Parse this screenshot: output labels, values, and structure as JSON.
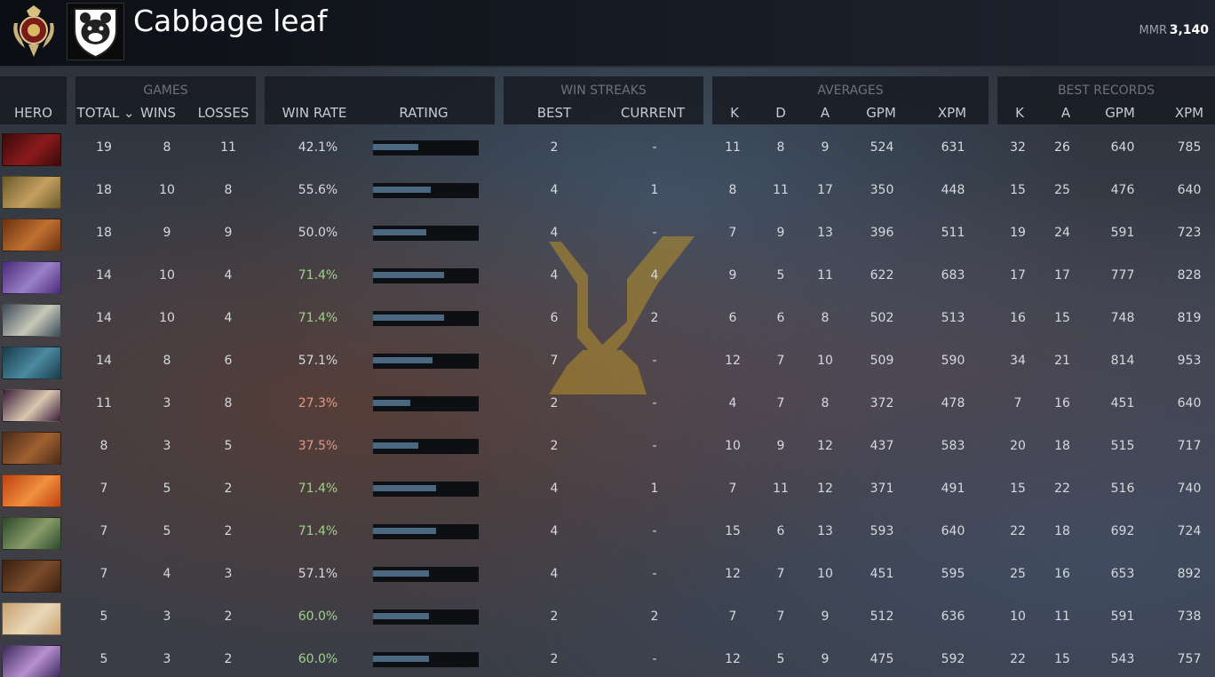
{
  "player": {
    "name": "Cabbage leaf",
    "mmr_label": "MMR",
    "mmr_value": "3,140"
  },
  "headers": {
    "hero": "HERO",
    "games": {
      "group": "GAMES",
      "total": "TOTAL ⌄",
      "wins": "WINS",
      "losses": "LOSSES"
    },
    "win_rate": "WIN RATE",
    "rating": "RATING",
    "win_streaks": {
      "group": "WIN STREAKS",
      "best": "BEST",
      "current": "CURRENT"
    },
    "averages": {
      "group": "AVERAGES",
      "k": "K",
      "d": "D",
      "a": "A",
      "gpm": "GPM",
      "xpm": "XPM"
    },
    "best_records": {
      "group": "BEST RECORDS",
      "k": "K",
      "a": "A",
      "gpm": "GPM",
      "xpm": "XPM"
    }
  },
  "colors": {
    "win_good": "#9fd08a",
    "win_bad": "#e09a86",
    "win_neutral": "#d6dade",
    "rating_bar": "#4a6880"
  },
  "rows": [
    {
      "hero": "shadow-fiend",
      "portrait": [
        "#3a0a0a",
        "#8b1b1b"
      ],
      "total": "19",
      "wins": "8",
      "losses": "11",
      "win_rate": "42.1%",
      "rating": 0.43,
      "streak_best": "2",
      "streak_current": "-",
      "avg_k": "11",
      "avg_d": "8",
      "avg_a": "9",
      "avg_gpm": "524",
      "avg_xpm": "631",
      "best_k": "32",
      "best_a": "26",
      "best_gpm": "640",
      "best_xpm": "785"
    },
    {
      "hero": "alchemist",
      "portrait": [
        "#6a5a2a",
        "#c4a060"
      ],
      "total": "18",
      "wins": "10",
      "losses": "8",
      "win_rate": "55.6%",
      "rating": 0.55,
      "streak_best": "4",
      "streak_current": "1",
      "avg_k": "8",
      "avg_d": "11",
      "avg_a": "17",
      "avg_gpm": "350",
      "avg_xpm": "448",
      "best_k": "15",
      "best_a": "25",
      "best_gpm": "476",
      "best_xpm": "640"
    },
    {
      "hero": "earthshaker",
      "portrait": [
        "#6a3010",
        "#c07030"
      ],
      "total": "18",
      "wins": "9",
      "losses": "9",
      "win_rate": "50.0%",
      "rating": 0.5,
      "streak_best": "4",
      "streak_current": "-",
      "avg_k": "7",
      "avg_d": "9",
      "avg_a": "13",
      "avg_gpm": "396",
      "avg_xpm": "511",
      "best_k": "19",
      "best_a": "24",
      "best_gpm": "591",
      "best_xpm": "723"
    },
    {
      "hero": "faceless-void",
      "portrait": [
        "#4a2a7a",
        "#9a80c8"
      ],
      "total": "14",
      "wins": "10",
      "losses": "4",
      "win_rate": "71.4%",
      "rating": 0.67,
      "streak_best": "4",
      "streak_current": "4",
      "avg_k": "9",
      "avg_d": "5",
      "avg_a": "11",
      "avg_gpm": "622",
      "avg_xpm": "683",
      "best_k": "17",
      "best_a": "17",
      "best_gpm": "777",
      "best_xpm": "828"
    },
    {
      "hero": "mirana",
      "portrait": [
        "#3a4a5a",
        "#c8c8b8"
      ],
      "total": "14",
      "wins": "10",
      "losses": "4",
      "win_rate": "71.4%",
      "rating": 0.67,
      "streak_best": "6",
      "streak_current": "2",
      "avg_k": "6",
      "avg_d": "6",
      "avg_a": "8",
      "avg_gpm": "502",
      "avg_xpm": "513",
      "best_k": "16",
      "best_a": "15",
      "best_gpm": "748",
      "best_xpm": "819"
    },
    {
      "hero": "phantom-assassin",
      "portrait": [
        "#1a3a4a",
        "#4a8aa0"
      ],
      "total": "14",
      "wins": "8",
      "losses": "6",
      "win_rate": "57.1%",
      "rating": 0.56,
      "streak_best": "7",
      "streak_current": "-",
      "avg_k": "12",
      "avg_d": "7",
      "avg_a": "10",
      "avg_gpm": "509",
      "avg_xpm": "590",
      "best_k": "34",
      "best_a": "21",
      "best_gpm": "814",
      "best_xpm": "953"
    },
    {
      "hero": "invoker",
      "portrait": [
        "#3a1a3a",
        "#d8c8b0"
      ],
      "total": "11",
      "wins": "3",
      "losses": "8",
      "win_rate": "27.3%",
      "rating": 0.35,
      "streak_best": "2",
      "streak_current": "-",
      "avg_k": "4",
      "avg_d": "7",
      "avg_a": "8",
      "avg_gpm": "372",
      "avg_xpm": "478",
      "best_k": "7",
      "best_a": "16",
      "best_gpm": "451",
      "best_xpm": "640"
    },
    {
      "hero": "monkey-king",
      "portrait": [
        "#4a2a1a",
        "#a06030"
      ],
      "total": "8",
      "wins": "3",
      "losses": "5",
      "win_rate": "37.5%",
      "rating": 0.43,
      "streak_best": "2",
      "streak_current": "-",
      "avg_k": "10",
      "avg_d": "9",
      "avg_a": "12",
      "avg_gpm": "437",
      "avg_xpm": "583",
      "best_k": "20",
      "best_a": "18",
      "best_gpm": "515",
      "best_xpm": "717"
    },
    {
      "hero": "lina",
      "portrait": [
        "#c04010",
        "#f09040"
      ],
      "total": "7",
      "wins": "5",
      "losses": "2",
      "win_rate": "71.4%",
      "rating": 0.6,
      "streak_best": "4",
      "streak_current": "1",
      "avg_k": "7",
      "avg_d": "11",
      "avg_a": "12",
      "avg_gpm": "371",
      "avg_xpm": "491",
      "best_k": "15",
      "best_a": "22",
      "best_gpm": "516",
      "best_xpm": "740"
    },
    {
      "hero": "sniper",
      "portrait": [
        "#2a4a2a",
        "#8a9a6a"
      ],
      "total": "7",
      "wins": "5",
      "losses": "2",
      "win_rate": "71.4%",
      "rating": 0.6,
      "streak_best": "4",
      "streak_current": "-",
      "avg_k": "15",
      "avg_d": "6",
      "avg_a": "13",
      "avg_gpm": "593",
      "avg_xpm": "640",
      "best_k": "22",
      "best_a": "18",
      "best_gpm": "692",
      "best_xpm": "724"
    },
    {
      "hero": "ursa",
      "portrait": [
        "#3a2010",
        "#7a4a2a"
      ],
      "total": "7",
      "wins": "4",
      "losses": "3",
      "win_rate": "57.1%",
      "rating": 0.53,
      "streak_best": "4",
      "streak_current": "-",
      "avg_k": "12",
      "avg_d": "7",
      "avg_a": "10",
      "avg_gpm": "451",
      "avg_xpm": "595",
      "best_k": "25",
      "best_a": "16",
      "best_gpm": "653",
      "best_xpm": "892"
    },
    {
      "hero": "dawnbreaker",
      "portrait": [
        "#c8a070",
        "#e8d8b8"
      ],
      "total": "5",
      "wins": "3",
      "losses": "2",
      "win_rate": "60.0%",
      "rating": 0.53,
      "streak_best": "2",
      "streak_current": "2",
      "avg_k": "7",
      "avg_d": "7",
      "avg_a": "9",
      "avg_gpm": "512",
      "avg_xpm": "636",
      "best_k": "10",
      "best_a": "11",
      "best_gpm": "591",
      "best_xpm": "738"
    },
    {
      "hero": "templar-assassin",
      "portrait": [
        "#3a2a5a",
        "#b890d0"
      ],
      "total": "5",
      "wins": "3",
      "losses": "2",
      "win_rate": "60.0%",
      "rating": 0.53,
      "streak_best": "2",
      "streak_current": "-",
      "avg_k": "12",
      "avg_d": "5",
      "avg_a": "9",
      "avg_gpm": "475",
      "avg_xpm": "592",
      "best_k": "22",
      "best_a": "15",
      "best_gpm": "543",
      "best_xpm": "757"
    }
  ]
}
